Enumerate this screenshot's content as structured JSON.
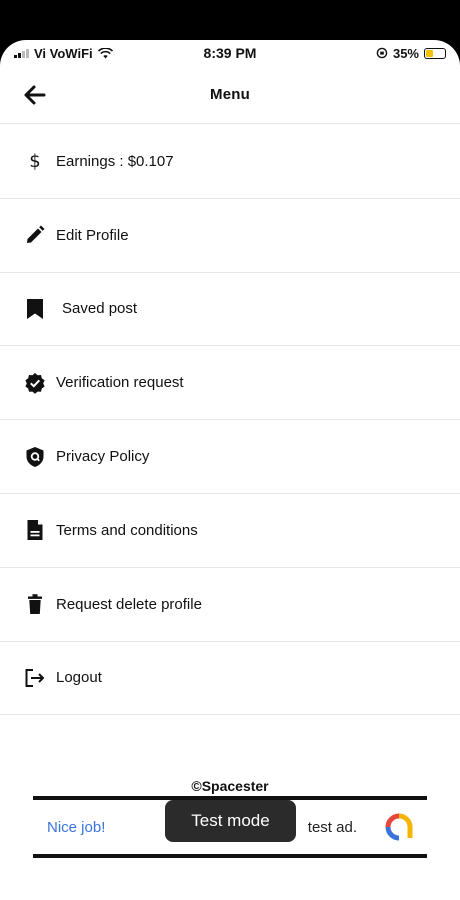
{
  "status_bar": {
    "carrier": "Vi VoWiFi",
    "time": "8:39 PM",
    "battery": "35%"
  },
  "header": {
    "title": "Menu"
  },
  "menu": {
    "items": [
      {
        "label": "Earnings : $0.107",
        "icon": "dollar-icon"
      },
      {
        "label": "Edit Profile",
        "icon": "pencil-icon"
      },
      {
        "label": "Saved post",
        "icon": "bookmark-icon"
      },
      {
        "label": "Verification request",
        "icon": "verified-badge-icon"
      },
      {
        "label": "Privacy Policy",
        "icon": "shield-icon"
      },
      {
        "label": "Terms and conditions",
        "icon": "document-icon"
      },
      {
        "label": "Request delete profile",
        "icon": "trash-icon"
      },
      {
        "label": "Logout",
        "icon": "logout-icon"
      }
    ]
  },
  "footer": {
    "copyright": "©Spacester"
  },
  "ad": {
    "nice_job": "Nice job!",
    "text": "test ad.",
    "toast": "Test mode"
  }
}
